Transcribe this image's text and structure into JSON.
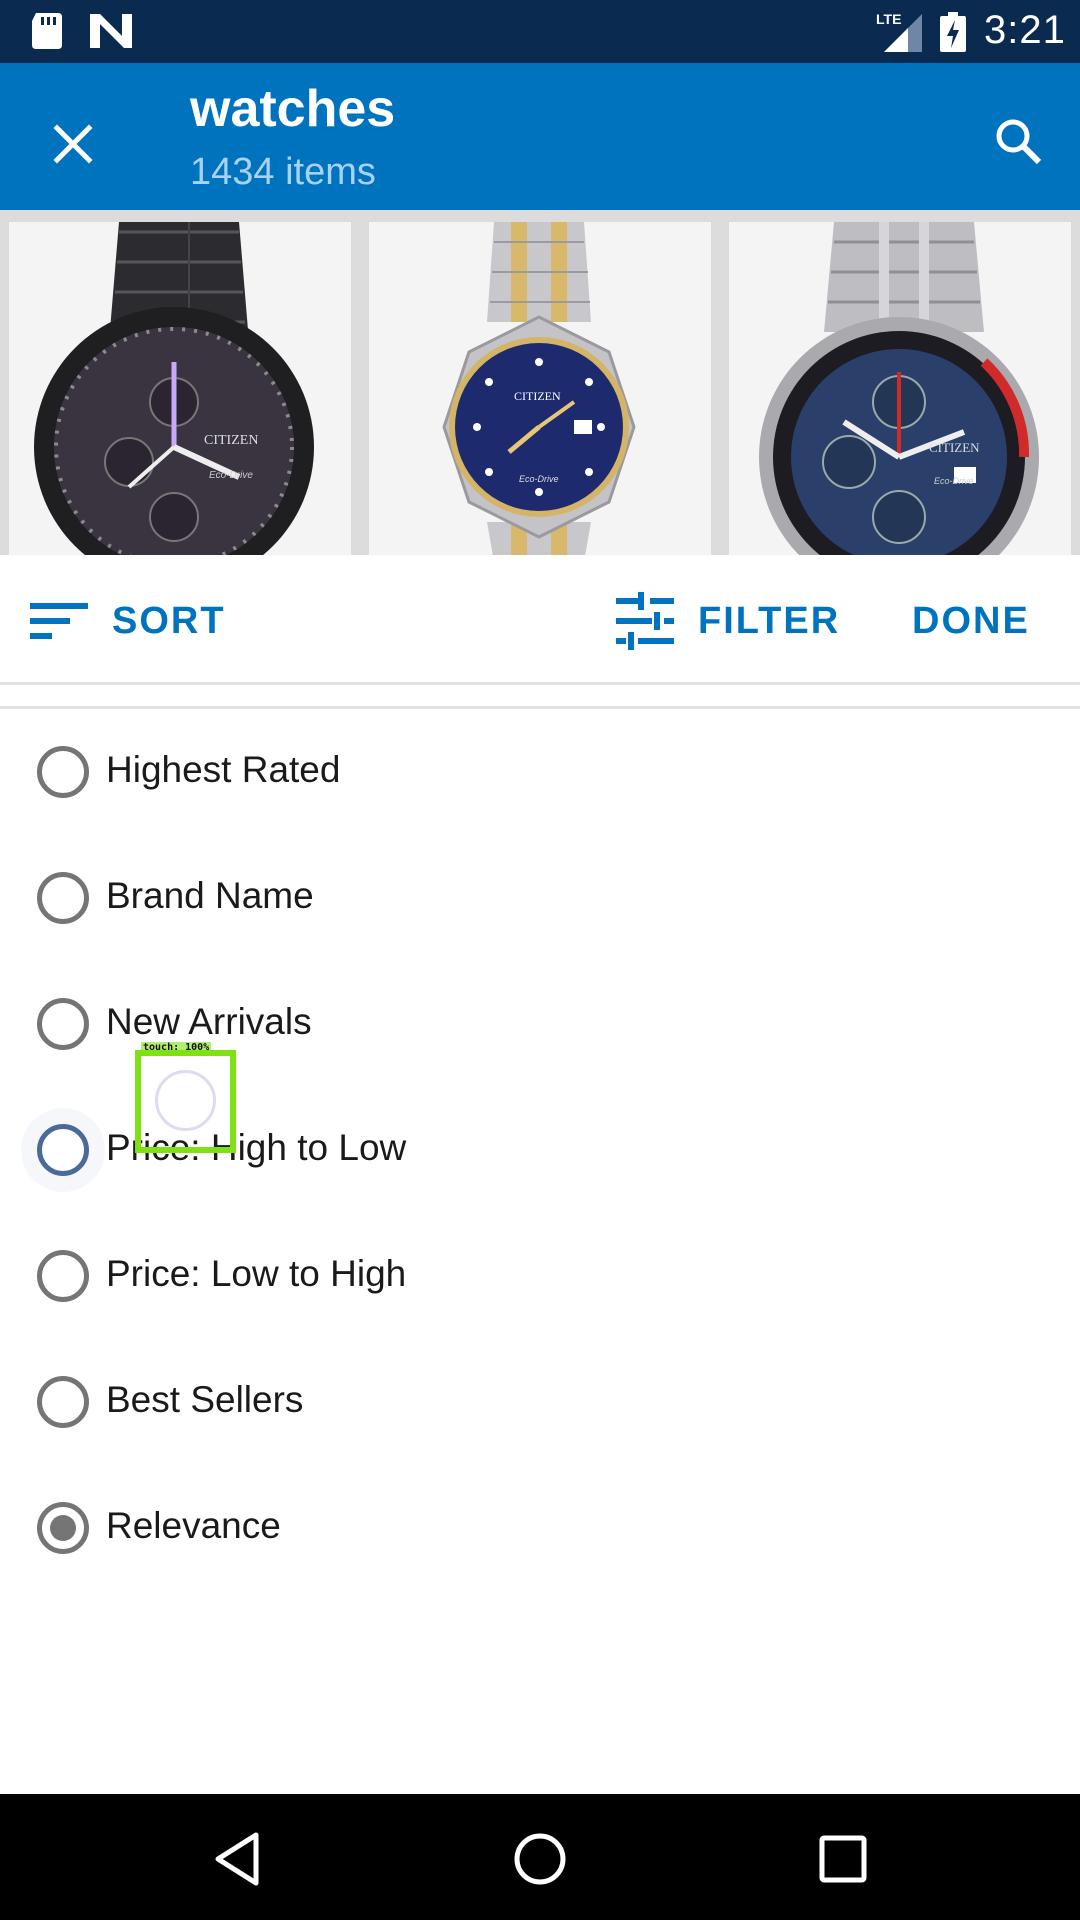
{
  "status_bar": {
    "time": "3:21",
    "icons": [
      "sd-card-icon",
      "n-icon",
      "lte-signal-icon",
      "battery-charging-icon"
    ]
  },
  "app_bar": {
    "title": "watches",
    "subtitle": "1434 items",
    "close_icon": "close-icon",
    "search_icon": "search-icon",
    "color": "#0073bf"
  },
  "products": [
    {
      "brand_text": "CITIZEN",
      "sub_text": "Eco-Drive",
      "dial_color": "#3a3440"
    },
    {
      "brand_text": "CITIZEN",
      "sub_text": "Eco-Drive",
      "dial_color": "#1d2a6e"
    },
    {
      "brand_text": "CITIZEN",
      "sub_text": "Eco-Drive",
      "dial_color": "#2b3f6b"
    }
  ],
  "sort_bar": {
    "sort_label": "SORT",
    "filter_label": "FILTER",
    "done_label": "DONE"
  },
  "sort_options": [
    {
      "label": "Highest Rated",
      "checked": false
    },
    {
      "label": "Brand Name",
      "checked": false
    },
    {
      "label": "New Arrivals",
      "checked": false
    },
    {
      "label": "Price: High to Low",
      "checked": false
    },
    {
      "label": "Price: Low to High",
      "checked": false
    },
    {
      "label": "Best Sellers",
      "checked": false
    },
    {
      "label": "Relevance",
      "checked": true
    }
  ],
  "touch_overlay": {
    "label": "touch: 100%"
  },
  "nav_bar": {
    "icons": [
      "back-icon",
      "home-icon",
      "recents-icon"
    ]
  }
}
